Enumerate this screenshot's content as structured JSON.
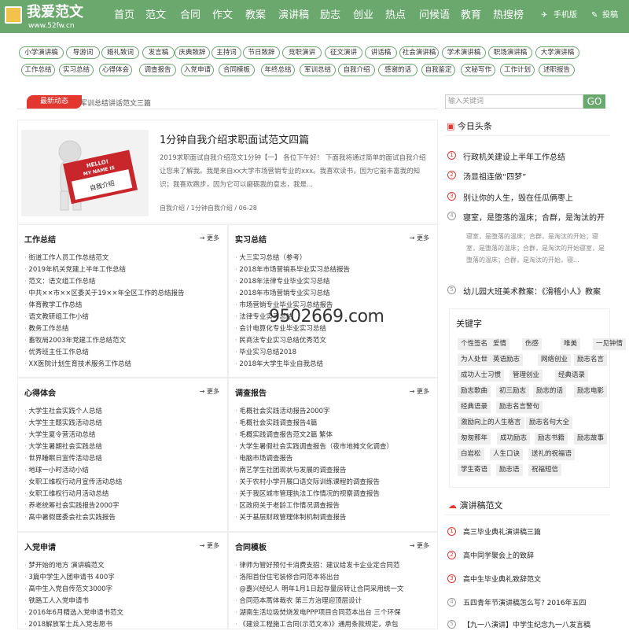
{
  "logo": {
    "title": "我爱范文",
    "url": "www.52fw.cn"
  },
  "nav": [
    "首页",
    "范文",
    "合同",
    "作文",
    "教案",
    "演讲稿",
    "励志",
    "创业",
    "热点",
    "问候语",
    "教育",
    "热搜榜"
  ],
  "nav_right": {
    "mobile": "手机版",
    "submit": "投稿"
  },
  "tags_row1": [
    "小学演讲稿",
    "导游词",
    "婚礼致词",
    "发言稿",
    "庆典致辞",
    "主持词",
    "节日致辞",
    "竞职演讲",
    "征文演讲",
    "讲话稿",
    "社会演讲稿",
    "学术演讲稿",
    "职场演讲稿",
    "大学演讲稿"
  ],
  "tags_row2": [
    "工作总结",
    "实习总结",
    "心得体会",
    "调查报告",
    "入党申请",
    "合同模板",
    "年终总结",
    "军训总结",
    "自我介绍",
    "感谢的话",
    "自我鉴定",
    "文秘写作",
    "工作计划",
    "述职报告"
  ],
  "latest": {
    "badge": "最新动态",
    "text": "军训总结讲话范文三篇"
  },
  "search": {
    "placeholder": "输入关键词",
    "button": "GO"
  },
  "featured": {
    "title": "1分钟自我介绍求职面试范文四篇",
    "desc": "2019求职面试自我介绍范文1分钟【一】 各位下午好！ 下面我将通过简单的面试自我介绍让您来了解我。我是来自xx大学市场营销专业的xxx。我喜欢读书，因为它能丰富我的知识；我喜欢跑步，因为它可以磨砺我的意志，我是...",
    "meta": "自我介绍 / 1分钟自我介绍 / 06-28",
    "image_text": [
      "HELLO!",
      "MY NAME IS",
      "自我介绍"
    ]
  },
  "more": "更多",
  "sections": [
    {
      "title": "工作总结",
      "items": [
        "街道工作人员工作总结范文",
        "2019年机关党建上半年工作总结",
        "范文：语文组工作总结",
        "中共××市××区委关于19××年全区工作的总结报告",
        "体育教学工作总结",
        "语文教研组工作小结",
        "教务工作总结",
        "畜牧局2003年党建工作总结范文",
        "优秀班主任工作总结",
        "XX医院计划生育技术服务工作总结"
      ]
    },
    {
      "title": "实习总结",
      "items": [
        "大三实习总结（参考）",
        "2018年市场营销系毕业实习总结报告",
        "2018年法律专业毕业实习总结",
        "2018年市场营销专业实习总结",
        "市场营销专业毕业实习总结报告",
        "法律专业实习总结",
        "会计电算化专业毕业实习总结",
        "民商法专业实习总结优秀范文",
        "毕业实习总结2018",
        "2018年大学生毕业自我总结"
      ]
    },
    {
      "title": "心得体会",
      "items": [
        "大学生社会实践个人总结",
        "大学生主题实践活动总结",
        "大学生夏令营活动总结",
        "大学生暑期社会实践总结",
        "世界睡眠日宣传活动总结",
        "地球一小时活动小结",
        "女职工维权行动月宣传活动总结",
        "女职工维权行动月活动总结",
        "养老统筹社会实践报告2000字",
        "高中暑假居委会社会实践报告"
      ]
    },
    {
      "title": "调查报告",
      "items": [
        "毛概社会实践活动报告2000字",
        "毛概社会实践调查报告4篇",
        "毛概实践调查报告范文2篇 繁体",
        "大学生暑假社会实践调查报告（夜市地摊文化调查）",
        "电脑市场调查报告",
        "南艺学生社团现状与发展的调查报告",
        "关于农村小学开展口语交际训练课程的调查报告",
        "关于我区城市管理执法工作情况的视察调查报告",
        "区政府关于老龄工作情况调查报告",
        "关于基层财政管理体制机制调查报告"
      ]
    },
    {
      "title": "入党申请",
      "items": [
        "梦开始的地方 演讲稿范文",
        "3篇中学生入团申请书 400字",
        "高中生入党自传范文3000字",
        "铁路工人入党申请书",
        "2016年6月精选入党申请书范文",
        "2018解放军士兵入党志愿书"
      ]
    },
    {
      "title": "合同模板",
      "items": [
        "律师为管好预付卡消费支招：建议给发卡企业定合同范",
        "洛阳首份住宅装修合同范本将出台",
        "@嘉兴经纪人 明年1月1日起存量房转让合同采用统一文",
        "合同范本蒿体裁农 第三方治理迎顶层设计",
        "湖南生活垃圾焚烧发电PPP项目合同范本出台 三个环保",
        "《建设工程施工合同(示范文本)》通用条款规定，承包"
      ]
    }
  ],
  "today": {
    "title": "今日头条",
    "items": [
      "行政机关建设上半年工作总结",
      "汤显祖连做“四梦”",
      "别让你的人生，毁在任瓜俩枣上",
      "寝室，是堕落的温床；合群，是淘汰的开"
    ],
    "sub": "寝室，是堕落的温床；合群，是淘汰的开始；寝室，是堕落的温床；合群，是淘汰的开始寝室，是堕落的温床；合群，是淘汰的开始，寝...",
    "item5": "幼儿园大班美术教案：《滑稽小人》教案"
  },
  "keywords": {
    "title": "关键字",
    "items": [
      "个性签名",
      "爱情",
      "伤感",
      "唯美",
      "一见钟情",
      "为人处世",
      "英语励志",
      "网络创业",
      "励志名言",
      "成功人士习惯",
      "管理创业",
      "经典语录",
      "励志歌曲",
      "初三励志",
      "励志的话",
      "励志电影",
      "经典语录",
      "励志名言警句",
      "激励向上的人生格言",
      "励志名句大全",
      "匆匆那年",
      "成功励志",
      "励志书籍",
      "励志故事",
      "白岩松",
      "人生口诀",
      "送礼的祝福语",
      "学生寄语",
      "励志语",
      "祝福短信"
    ]
  },
  "speech": {
    "title": "演讲稿范文",
    "items": [
      "高三毕业典礼演讲稿三篇",
      "高中同学聚会上的致辞",
      "高中生毕业典礼致辞范文",
      "五四青年节演讲稿怎么写? 2016年五四",
      "【九一八演讲】中学生纪念九一八发言稿"
    ]
  },
  "watermark": "9502669.com",
  "colors": {
    "brand": "#6aa86d",
    "accent": "#e2362f"
  }
}
